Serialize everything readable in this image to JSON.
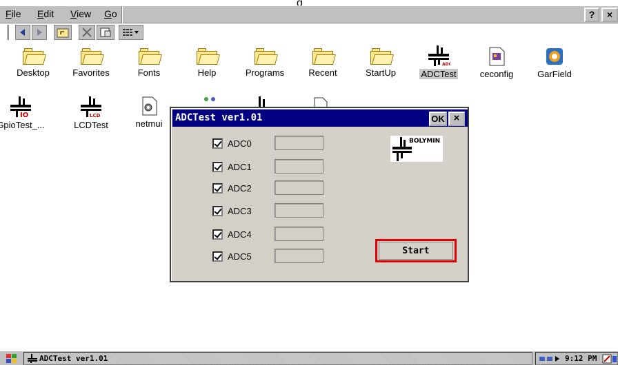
{
  "window_top_clip": "g",
  "menubar": {
    "items": [
      {
        "label": "File",
        "underline": "F"
      },
      {
        "label": "Edit",
        "underline": "E"
      },
      {
        "label": "View",
        "underline": "V"
      },
      {
        "label": "Go",
        "underline": "G"
      }
    ],
    "help_label": "?",
    "close_label": "×"
  },
  "toolbar": {
    "buttons": [
      "back-arrow-icon",
      "forward-arrow-icon",
      "up-folder-icon",
      "delete-icon",
      "properties-icon",
      "view-menu-icon"
    ]
  },
  "desktop_icons": [
    {
      "label": "Desktop",
      "icon": "folder-icon"
    },
    {
      "label": "Favorites",
      "icon": "folder-icon"
    },
    {
      "label": "Fonts",
      "icon": "folder-icon"
    },
    {
      "label": "Help",
      "icon": "folder-icon"
    },
    {
      "label": "Programs",
      "icon": "folder-icon"
    },
    {
      "label": "Recent",
      "icon": "folder-icon"
    },
    {
      "label": "StartUp",
      "icon": "folder-icon"
    },
    {
      "label": "ADCTest",
      "icon": "bolymin-adc-icon",
      "selected": true
    },
    {
      "label": "ceconfig",
      "icon": "document-icon"
    },
    {
      "label": "GarField",
      "icon": "garfield-icon"
    },
    {
      "label": "GpioTest_...",
      "icon": "bolymin-io-icon"
    },
    {
      "label": "LCDTest",
      "icon": "bolymin-lcd-icon"
    },
    {
      "label": "netmui",
      "icon": "gear-doc-icon"
    }
  ],
  "dialog": {
    "title": "ADCTest ver1.01",
    "ok_label": "OK",
    "close_label": "×",
    "channels": [
      {
        "label": "ADC0",
        "checked": true,
        "value": ""
      },
      {
        "label": "ADC1",
        "checked": true,
        "value": ""
      },
      {
        "label": "ADC2",
        "checked": true,
        "value": ""
      },
      {
        "label": "ADC3",
        "checked": true,
        "value": ""
      },
      {
        "label": "ADC4",
        "checked": true,
        "value": ""
      },
      {
        "label": "ADC5",
        "checked": true,
        "value": ""
      }
    ],
    "logo_text": "BOLYMIN",
    "start_label": "Start",
    "highlight_color": "#e00000"
  },
  "taskbar": {
    "task_label": "ADCTest ver1.01",
    "clock": "9:12 PM"
  },
  "colors": {
    "titlebar": "#000080",
    "face": "#d4d0c8",
    "folder": "#ffe78a"
  }
}
